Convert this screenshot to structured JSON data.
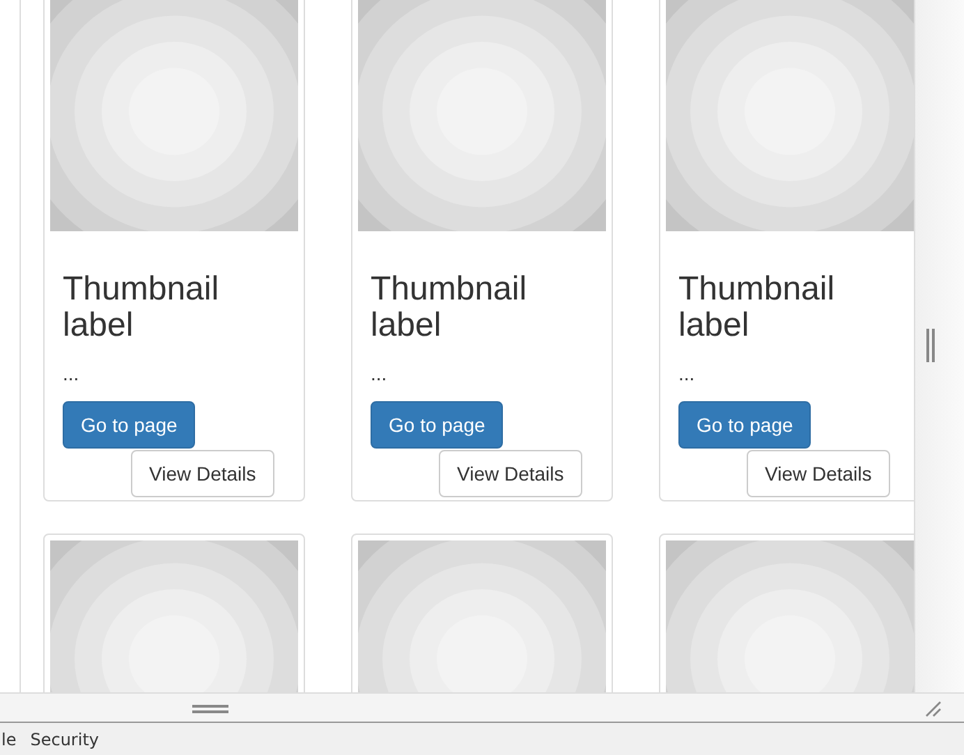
{
  "cards": [
    {
      "kind": "thumbnail",
      "title": "Thumbnail label",
      "text": "...",
      "primary_button": "Go to page",
      "secondary_button": "View Details"
    },
    {
      "kind": "thumbnail",
      "title": "Thumbnail label",
      "text": "...",
      "primary_button": "Go to page",
      "secondary_button": "View Details"
    },
    {
      "kind": "thumbnail",
      "title": "Thumbnail label",
      "text": "...",
      "primary_button": "Go to page",
      "secondary_button": "View Details"
    },
    {
      "kind": "picture"
    },
    {
      "kind": "picture"
    },
    {
      "kind": "picture"
    }
  ],
  "status_bar": {
    "tabs": [
      "le",
      "Security"
    ]
  }
}
